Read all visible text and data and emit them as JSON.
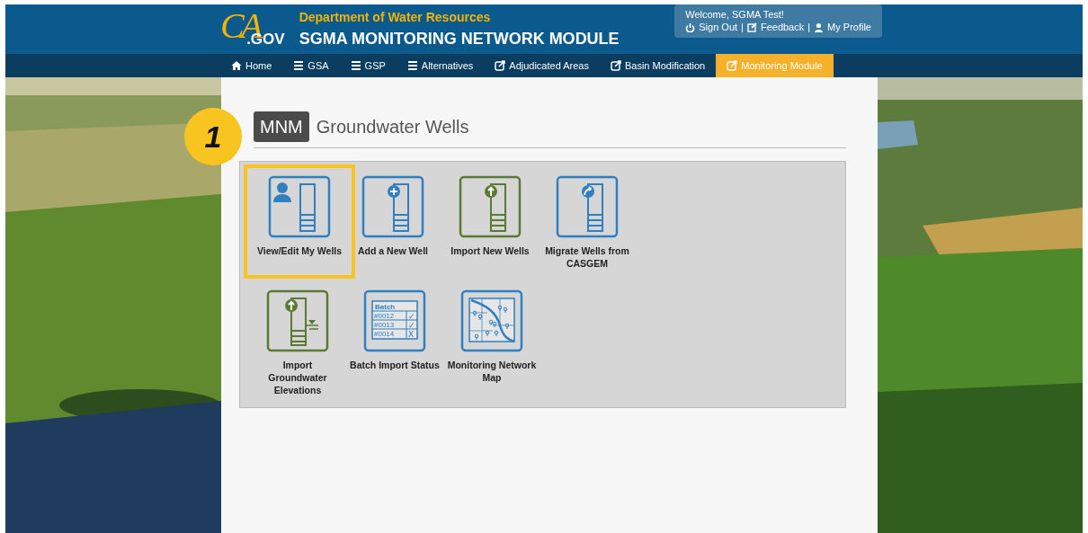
{
  "header": {
    "logo": {
      "mark": "CA",
      "suffix": ".GOV"
    },
    "department": "Department of Water Resources",
    "title": "SGMA MONITORING NETWORK MODULE",
    "user": {
      "welcome": "Welcome, SGMA Test!",
      "links": [
        {
          "kind": "power",
          "label": "Sign Out"
        },
        {
          "kind": "edit",
          "label": "Feedback"
        },
        {
          "kind": "user",
          "label": "My Profile"
        }
      ],
      "separator": "|"
    }
  },
  "nav": [
    {
      "kind": "home",
      "label": "Home",
      "selected": false
    },
    {
      "kind": "menu",
      "label": "GSA",
      "selected": false
    },
    {
      "kind": "menu",
      "label": "GSP",
      "selected": false
    },
    {
      "kind": "menu",
      "label": "Alternatives",
      "selected": false
    },
    {
      "kind": "external",
      "label": "Adjudicated Areas",
      "selected": false
    },
    {
      "kind": "external",
      "label": "Basin Modification",
      "selected": false
    },
    {
      "kind": "external",
      "label": "Monitoring Module",
      "selected": true
    }
  ],
  "callout": "1",
  "heading": {
    "badge": "MNM",
    "title": "Groundwater Wells"
  },
  "tiles": [
    [
      {
        "kind": "person",
        "color": "#2f7fc1",
        "label": "View/Edit My Wells",
        "selected": true
      },
      {
        "kind": "plus",
        "color": "#2f7fc1",
        "label": "Add a New Well",
        "selected": false
      },
      {
        "kind": "up",
        "color": "#5a7a34",
        "label": "Import New Wells",
        "selected": false
      },
      {
        "kind": "share",
        "color": "#2f7fc1",
        "label": "Migrate Wells from CASGEM",
        "selected": false
      }
    ],
    [
      {
        "kind": "elevation",
        "color": "#5a7a34",
        "label": "Import Groundwater Elevations",
        "selected": false
      },
      {
        "kind": "batch",
        "color": "#2f7fc1",
        "label": "Batch Import Status",
        "selected": false,
        "table": {
          "title": "Batch",
          "rows": [
            {
              "id": "#0012",
              "mark": "✓"
            },
            {
              "id": "#0013",
              "mark": "✓"
            },
            {
              "id": "#0014",
              "mark": "X"
            }
          ]
        }
      },
      {
        "kind": "map",
        "color": "#2f7fc1",
        "label": "Monitoring Network Map",
        "selected": false
      }
    ]
  ]
}
